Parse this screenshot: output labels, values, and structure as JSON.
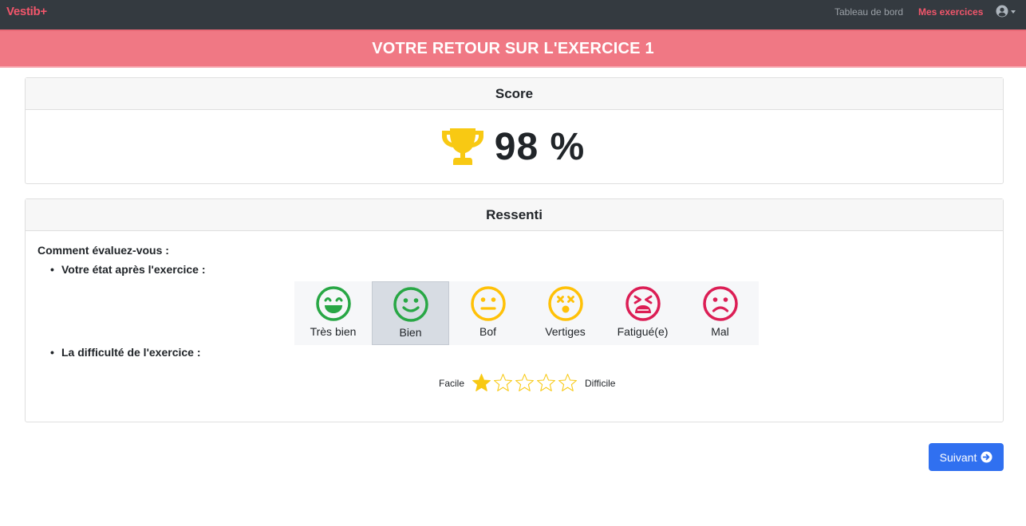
{
  "navbar": {
    "brand": "Vestib+",
    "links": {
      "dashboard": "Tableau de bord",
      "exercises": "Mes exercices"
    },
    "user_icon": "user-circle-icon"
  },
  "banner": {
    "title": "VOTRE RETOUR SUR L'EXERCICE 1"
  },
  "score": {
    "header": "Score",
    "value": "98 %",
    "icon": "trophy-icon"
  },
  "feeling": {
    "header": "Ressenti",
    "question": "Comment évaluez-vous :",
    "state_label": "Votre état après l'exercice :",
    "moods": [
      {
        "label": "Très bien",
        "icon": "grin-icon",
        "color": "#28a745"
      },
      {
        "label": "Bien",
        "icon": "smile-icon",
        "color": "#28a745",
        "selected": true
      },
      {
        "label": "Bof",
        "icon": "neutral-face-icon",
        "color": "#ffc107"
      },
      {
        "label": "Vertiges",
        "icon": "dizzy-face-icon",
        "color": "#ffc107"
      },
      {
        "label": "Fatigué(e)",
        "icon": "tired-face-icon",
        "color": "#dc1e55"
      },
      {
        "label": "Mal",
        "icon": "frown-icon",
        "color": "#dc1e55"
      }
    ],
    "difficulty_label": "La difficulté de l'exercice :",
    "difficulty": {
      "min_label": "Facile",
      "max_label": "Difficile",
      "value": 1,
      "max": 5
    }
  },
  "next_button": {
    "label": "Suivant"
  },
  "colors": {
    "navbar": "#343a40",
    "brand": "#f2566b",
    "banner": "#f07884",
    "trophy": "#f8c913",
    "star": "#f8c913",
    "primary": "#3070f0"
  }
}
